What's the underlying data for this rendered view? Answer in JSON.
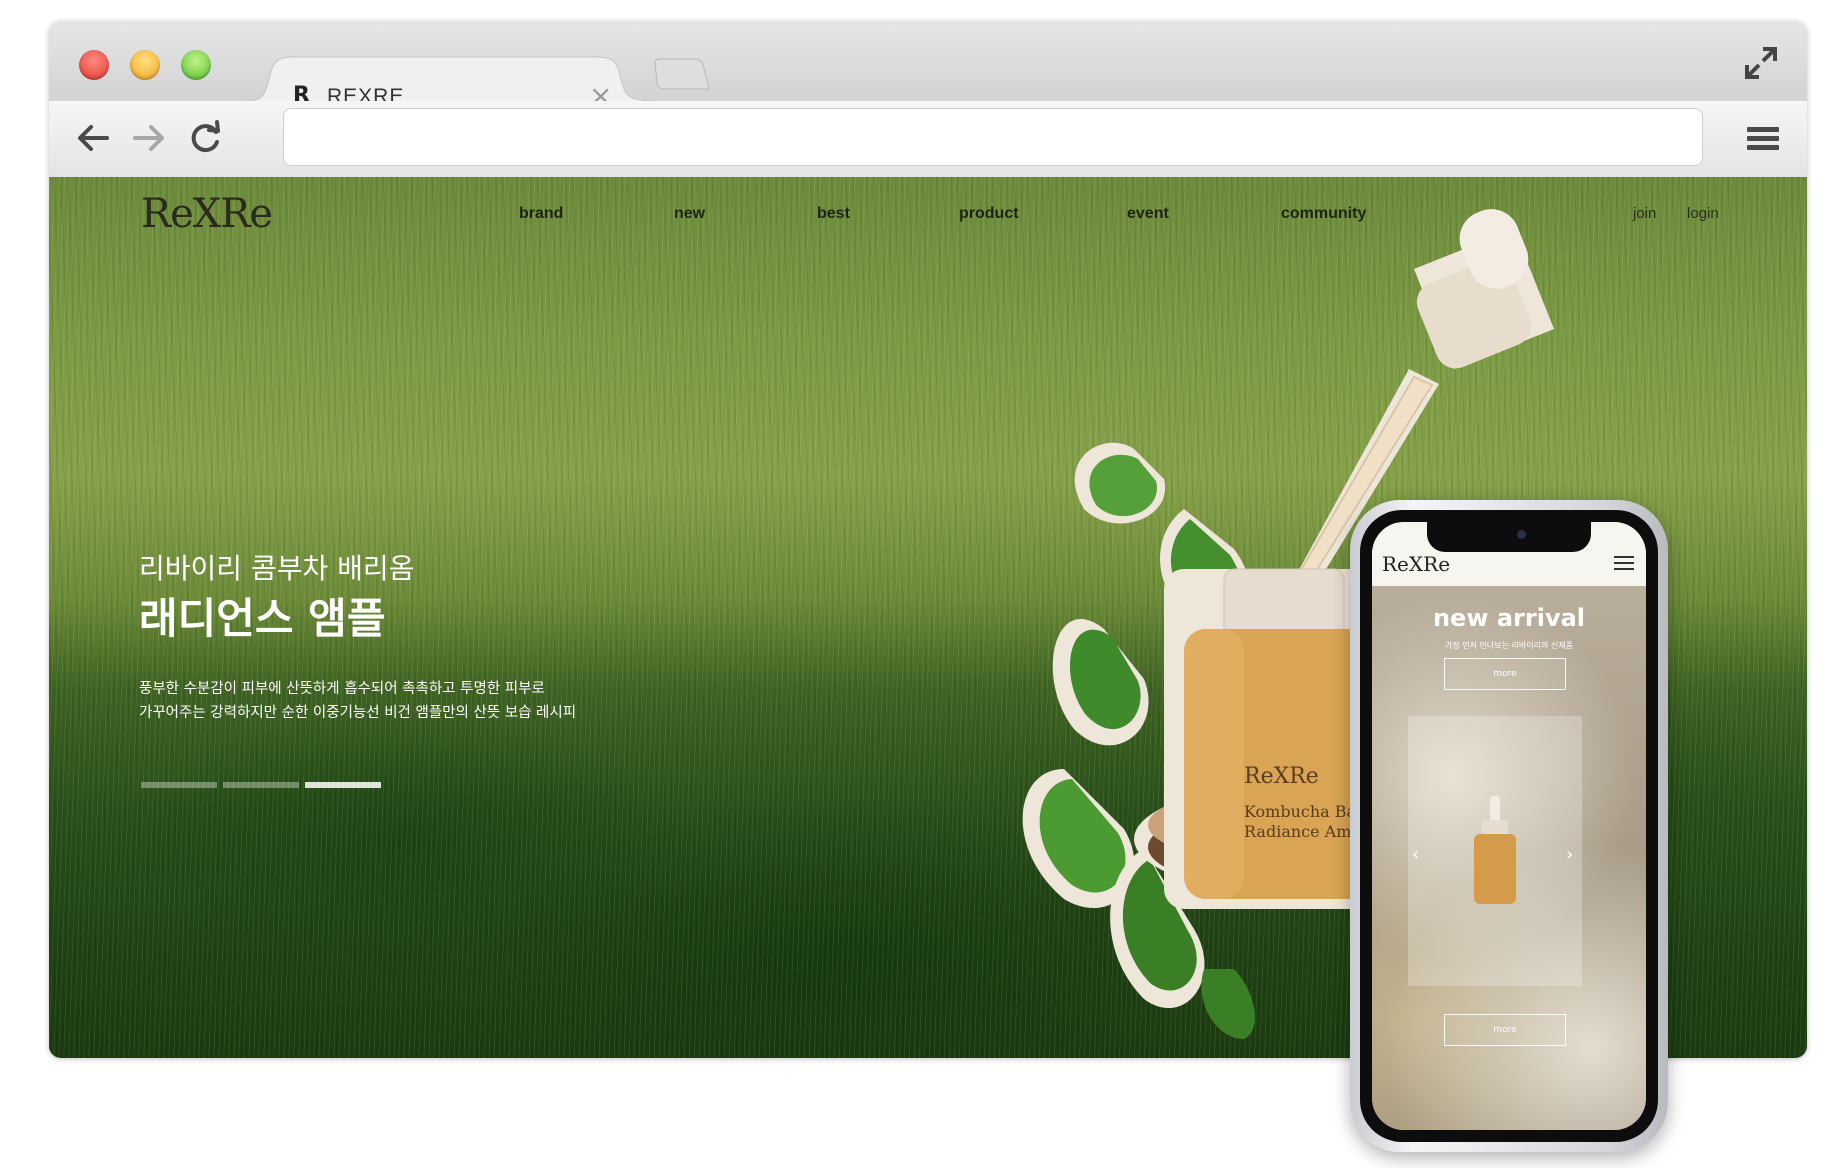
{
  "browser": {
    "tab": {
      "favicon": "R",
      "title": "REXRE",
      "close_label": "×"
    },
    "url": {
      "value": "",
      "placeholder": ""
    },
    "icons": [
      "back-arrow-icon",
      "forward-arrow-icon",
      "reload-icon",
      "hamburger-menu-icon",
      "fullscreen-icon",
      "close-icon"
    ]
  },
  "site": {
    "logo": "ReXRe",
    "nav": [
      {
        "label": "brand"
      },
      {
        "label": "new"
      },
      {
        "label": "best"
      },
      {
        "label": "product"
      },
      {
        "label": "event"
      },
      {
        "label": "community"
      }
    ],
    "account": {
      "join": "join",
      "login": "login"
    },
    "hero": {
      "subtitle": "리바이리 콤부차 배리옴",
      "title": "래디언스 앰플",
      "desc_line1": "풍부한 수분감이 피부에 산뜻하게 흡수되어 촉촉하고 투명한 피부로",
      "desc_line2": "가꾸어주는 강력하지만 순한 이중기능선 비건 앰플만의 산뜻 보습 레시피"
    },
    "slider": {
      "count": 3,
      "active_index": 3
    },
    "product_bottle": {
      "brand": "ReXRe",
      "line1": "Kombucha Barrio",
      "line2": "Radiance Ampoul"
    }
  },
  "mobile": {
    "logo": "ReXRe",
    "title": "new arrival",
    "subtitle": "가장 먼저 만나보는 리바이리의 신제품",
    "more_top": "more",
    "more_bottom": "more",
    "prev": "‹",
    "next": "›"
  },
  "colors": {
    "accent_cream": "#efe6da",
    "amber": "#c98a3c",
    "leaf": "#3f8a2a"
  }
}
